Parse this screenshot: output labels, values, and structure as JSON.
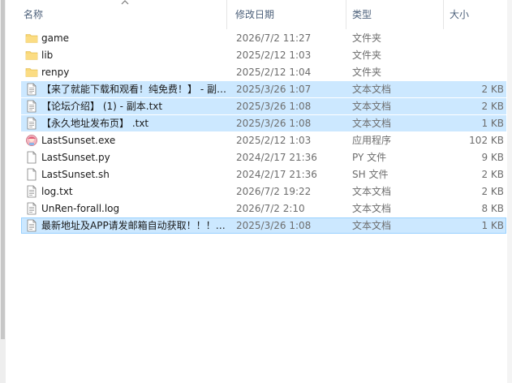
{
  "columns": {
    "name": "名称",
    "date": "修改日期",
    "type": "类型",
    "size": "大小"
  },
  "files": [
    {
      "name": "game",
      "date": "2026/7/2 11:27",
      "type": "文件夹",
      "size": "",
      "icon": "folder-icon"
    },
    {
      "name": "lib",
      "date": "2025/2/12 1:03",
      "type": "文件夹",
      "size": "",
      "icon": "folder-icon"
    },
    {
      "name": "renpy",
      "date": "2025/2/12 1:04",
      "type": "文件夹",
      "size": "",
      "icon": "folder-icon"
    },
    {
      "name": "【来了就能下载和观看！纯免费！】 - 副本.txt",
      "date": "2025/3/26 1:07",
      "type": "文本文档",
      "size": "2 KB",
      "icon": "text-file-icon",
      "selected": true
    },
    {
      "name": "【论坛介绍】 (1) - 副本.txt",
      "date": "2025/3/26 1:08",
      "type": "文本文档",
      "size": "2 KB",
      "icon": "text-file-icon",
      "selected": true
    },
    {
      "name": "【永久地址发布页】 .txt",
      "date": "2025/3/26 1:08",
      "type": "文本文档",
      "size": "1 KB",
      "icon": "text-file-icon",
      "selected": true
    },
    {
      "name": "LastSunset.exe",
      "date": "2025/2/12 1:03",
      "type": "应用程序",
      "size": "102 KB",
      "icon": "app-exe-icon"
    },
    {
      "name": "LastSunset.py",
      "date": "2024/2/17 21:36",
      "type": "PY 文件",
      "size": "9 KB",
      "icon": "blank-file-icon"
    },
    {
      "name": "LastSunset.sh",
      "date": "2024/2/17 21:36",
      "type": "SH 文件",
      "size": "2 KB",
      "icon": "blank-file-icon"
    },
    {
      "name": "log.txt",
      "date": "2026/7/2 19:22",
      "type": "文本文档",
      "size": "2 KB",
      "icon": "text-file-icon"
    },
    {
      "name": "UnRen-forall.log",
      "date": "2026/7/2 2:10",
      "type": "文本文档",
      "size": "8 KB",
      "icon": "text-file-icon"
    },
    {
      "name": "最新地址及APP请发邮箱自动获取！！！.txt",
      "date": "2025/3/26 1:08",
      "type": "文本文档",
      "size": "1 KB",
      "icon": "text-file-icon",
      "selected": true,
      "focused": true
    }
  ],
  "colors": {
    "header_text": "#4c607a",
    "selection": "#cce8ff",
    "focus_border": "#99d1ff",
    "folder": "#f8d775"
  }
}
